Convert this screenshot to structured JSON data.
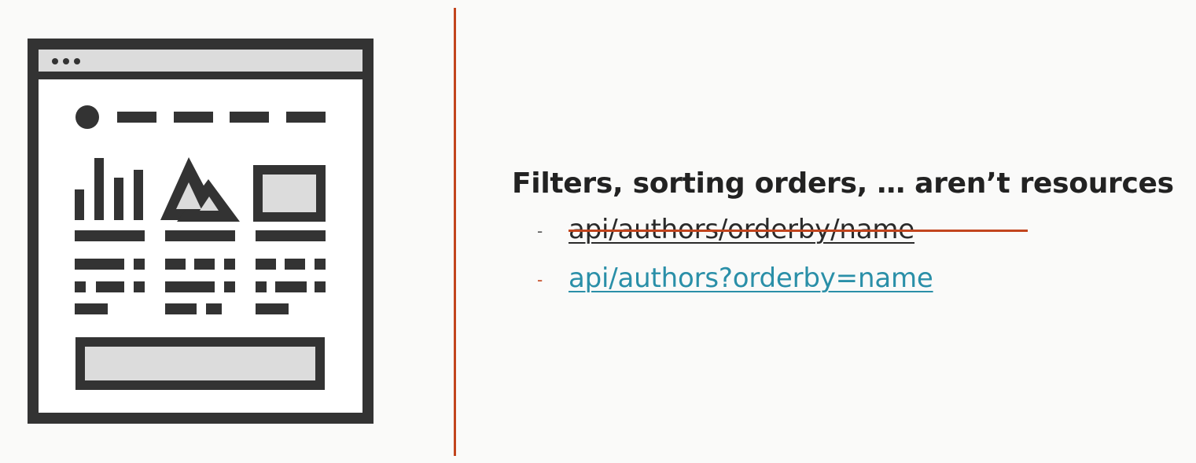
{
  "slide": {
    "heading": "Filters, sorting orders, … aren’t resources",
    "items": [
      {
        "bullet": "-",
        "text": "api/authors/orderby/name",
        "style": "struck"
      },
      {
        "bullet": "-",
        "text": "api/authors?orderby=name",
        "style": "link"
      }
    ]
  },
  "colors": {
    "accent": "#c2451e",
    "link": "#2a8fa8",
    "dark": "#333333",
    "light_fill": "#dcdcdc"
  },
  "icons": [
    "browser-window-icon"
  ]
}
